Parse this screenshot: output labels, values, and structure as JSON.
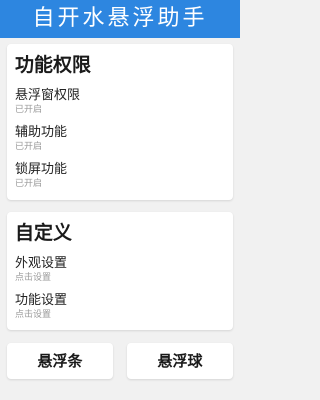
{
  "header": {
    "title": "自开水悬浮助手"
  },
  "permissions_card": {
    "title": "功能权限",
    "items": [
      {
        "label": "悬浮窗权限",
        "status": "已开启"
      },
      {
        "label": "辅助功能",
        "status": "已开启"
      },
      {
        "label": "锁屏功能",
        "status": "已开启"
      }
    ]
  },
  "custom_card": {
    "title": "自定义",
    "items": [
      {
        "label": "外观设置",
        "hint": "点击设置"
      },
      {
        "label": "功能设置",
        "hint": "点击设置"
      }
    ]
  },
  "buttons": {
    "floating_bar": "悬浮条",
    "floating_ball": "悬浮球"
  }
}
